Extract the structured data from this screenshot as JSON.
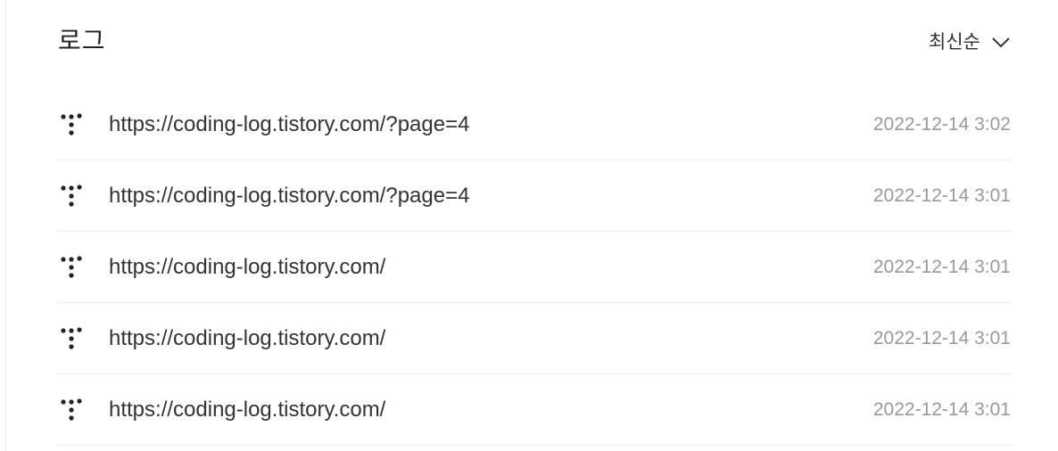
{
  "header": {
    "title": "로그",
    "sort_label": "최신순",
    "sort_icon": "chevron-down-icon"
  },
  "logs": [
    {
      "icon": "referrer-dots-icon",
      "url": "https://coding-log.tistory.com/?page=4",
      "time": "2022-12-14 3:02"
    },
    {
      "icon": "referrer-dots-icon",
      "url": "https://coding-log.tistory.com/?page=4",
      "time": "2022-12-14 3:01"
    },
    {
      "icon": "referrer-dots-icon",
      "url": "https://coding-log.tistory.com/",
      "time": "2022-12-14 3:01"
    },
    {
      "icon": "referrer-dots-icon",
      "url": "https://coding-log.tistory.com/",
      "time": "2022-12-14 3:01"
    },
    {
      "icon": "referrer-dots-icon",
      "url": "https://coding-log.tistory.com/",
      "time": "2022-12-14 3:01"
    }
  ],
  "colors": {
    "text_primary": "#333333",
    "text_muted": "#9a9a9a",
    "divider": "#ececec"
  }
}
